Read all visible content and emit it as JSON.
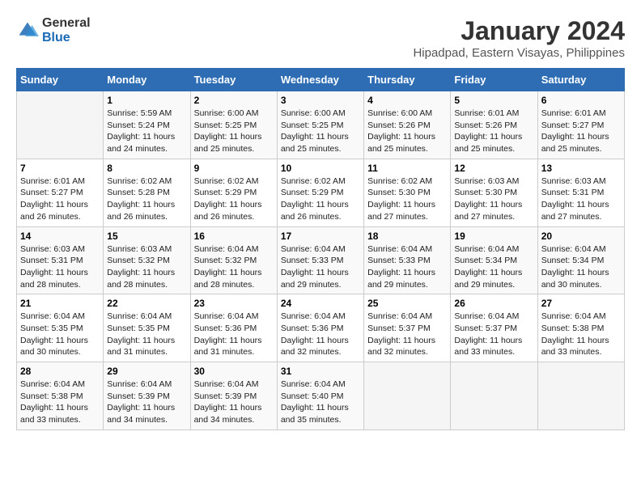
{
  "header": {
    "logo_line1": "General",
    "logo_line2": "Blue",
    "title": "January 2024",
    "subtitle": "Hipadpad, Eastern Visayas, Philippines"
  },
  "weekdays": [
    "Sunday",
    "Monday",
    "Tuesday",
    "Wednesday",
    "Thursday",
    "Friday",
    "Saturday"
  ],
  "weeks": [
    [
      {
        "day": "",
        "info": ""
      },
      {
        "day": "1",
        "info": "Sunrise: 5:59 AM\nSunset: 5:24 PM\nDaylight: 11 hours\nand 24 minutes."
      },
      {
        "day": "2",
        "info": "Sunrise: 6:00 AM\nSunset: 5:25 PM\nDaylight: 11 hours\nand 25 minutes."
      },
      {
        "day": "3",
        "info": "Sunrise: 6:00 AM\nSunset: 5:25 PM\nDaylight: 11 hours\nand 25 minutes."
      },
      {
        "day": "4",
        "info": "Sunrise: 6:00 AM\nSunset: 5:26 PM\nDaylight: 11 hours\nand 25 minutes."
      },
      {
        "day": "5",
        "info": "Sunrise: 6:01 AM\nSunset: 5:26 PM\nDaylight: 11 hours\nand 25 minutes."
      },
      {
        "day": "6",
        "info": "Sunrise: 6:01 AM\nSunset: 5:27 PM\nDaylight: 11 hours\nand 25 minutes."
      }
    ],
    [
      {
        "day": "7",
        "info": "Sunrise: 6:01 AM\nSunset: 5:27 PM\nDaylight: 11 hours\nand 26 minutes."
      },
      {
        "day": "8",
        "info": "Sunrise: 6:02 AM\nSunset: 5:28 PM\nDaylight: 11 hours\nand 26 minutes."
      },
      {
        "day": "9",
        "info": "Sunrise: 6:02 AM\nSunset: 5:29 PM\nDaylight: 11 hours\nand 26 minutes."
      },
      {
        "day": "10",
        "info": "Sunrise: 6:02 AM\nSunset: 5:29 PM\nDaylight: 11 hours\nand 26 minutes."
      },
      {
        "day": "11",
        "info": "Sunrise: 6:02 AM\nSunset: 5:30 PM\nDaylight: 11 hours\nand 27 minutes."
      },
      {
        "day": "12",
        "info": "Sunrise: 6:03 AM\nSunset: 5:30 PM\nDaylight: 11 hours\nand 27 minutes."
      },
      {
        "day": "13",
        "info": "Sunrise: 6:03 AM\nSunset: 5:31 PM\nDaylight: 11 hours\nand 27 minutes."
      }
    ],
    [
      {
        "day": "14",
        "info": "Sunrise: 6:03 AM\nSunset: 5:31 PM\nDaylight: 11 hours\nand 28 minutes."
      },
      {
        "day": "15",
        "info": "Sunrise: 6:03 AM\nSunset: 5:32 PM\nDaylight: 11 hours\nand 28 minutes."
      },
      {
        "day": "16",
        "info": "Sunrise: 6:04 AM\nSunset: 5:32 PM\nDaylight: 11 hours\nand 28 minutes."
      },
      {
        "day": "17",
        "info": "Sunrise: 6:04 AM\nSunset: 5:33 PM\nDaylight: 11 hours\nand 29 minutes."
      },
      {
        "day": "18",
        "info": "Sunrise: 6:04 AM\nSunset: 5:33 PM\nDaylight: 11 hours\nand 29 minutes."
      },
      {
        "day": "19",
        "info": "Sunrise: 6:04 AM\nSunset: 5:34 PM\nDaylight: 11 hours\nand 29 minutes."
      },
      {
        "day": "20",
        "info": "Sunrise: 6:04 AM\nSunset: 5:34 PM\nDaylight: 11 hours\nand 30 minutes."
      }
    ],
    [
      {
        "day": "21",
        "info": "Sunrise: 6:04 AM\nSunset: 5:35 PM\nDaylight: 11 hours\nand 30 minutes."
      },
      {
        "day": "22",
        "info": "Sunrise: 6:04 AM\nSunset: 5:35 PM\nDaylight: 11 hours\nand 31 minutes."
      },
      {
        "day": "23",
        "info": "Sunrise: 6:04 AM\nSunset: 5:36 PM\nDaylight: 11 hours\nand 31 minutes."
      },
      {
        "day": "24",
        "info": "Sunrise: 6:04 AM\nSunset: 5:36 PM\nDaylight: 11 hours\nand 32 minutes."
      },
      {
        "day": "25",
        "info": "Sunrise: 6:04 AM\nSunset: 5:37 PM\nDaylight: 11 hours\nand 32 minutes."
      },
      {
        "day": "26",
        "info": "Sunrise: 6:04 AM\nSunset: 5:37 PM\nDaylight: 11 hours\nand 33 minutes."
      },
      {
        "day": "27",
        "info": "Sunrise: 6:04 AM\nSunset: 5:38 PM\nDaylight: 11 hours\nand 33 minutes."
      }
    ],
    [
      {
        "day": "28",
        "info": "Sunrise: 6:04 AM\nSunset: 5:38 PM\nDaylight: 11 hours\nand 33 minutes."
      },
      {
        "day": "29",
        "info": "Sunrise: 6:04 AM\nSunset: 5:39 PM\nDaylight: 11 hours\nand 34 minutes."
      },
      {
        "day": "30",
        "info": "Sunrise: 6:04 AM\nSunset: 5:39 PM\nDaylight: 11 hours\nand 34 minutes."
      },
      {
        "day": "31",
        "info": "Sunrise: 6:04 AM\nSunset: 5:40 PM\nDaylight: 11 hours\nand 35 minutes."
      },
      {
        "day": "",
        "info": ""
      },
      {
        "day": "",
        "info": ""
      },
      {
        "day": "",
        "info": ""
      }
    ]
  ]
}
